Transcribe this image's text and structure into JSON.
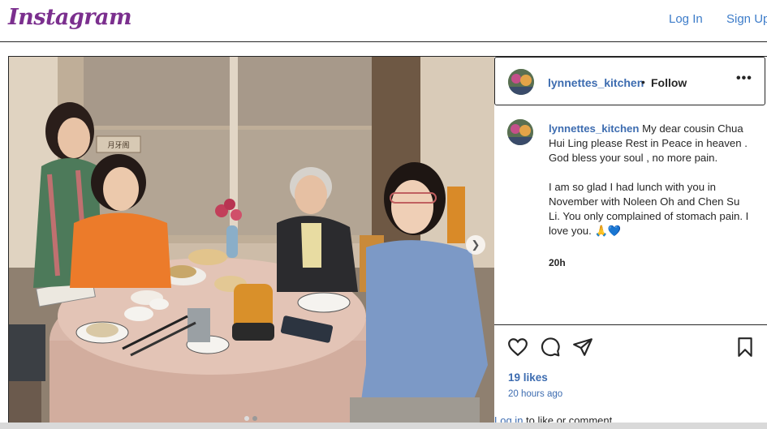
{
  "header": {
    "logo": "Instagram",
    "login": "Log In",
    "signup": "Sign Up"
  },
  "post": {
    "username": "lynnettes_kitchen",
    "separator": "•",
    "follow": "Follow",
    "more": "•••",
    "caption_line1": "My dear cousin Chua Hui Ling please Rest in Peace in heaven . God bless your soul , no more pain.",
    "caption_line2": "I am so glad I had lunch with you in November with Noleen Oh and Chen Su Li. You only complained of stomach pain. I love you. 🙏💙",
    "caption_time": "20h",
    "likes": "19 likes",
    "posted_ago": "20 hours ago",
    "login_link": "Log in",
    "login_suffix": " to like or comment."
  },
  "photo": {
    "wall_sign": "月牙阁"
  },
  "colors": {
    "brand": "#7b2f8e",
    "link": "#3d7cc9"
  }
}
